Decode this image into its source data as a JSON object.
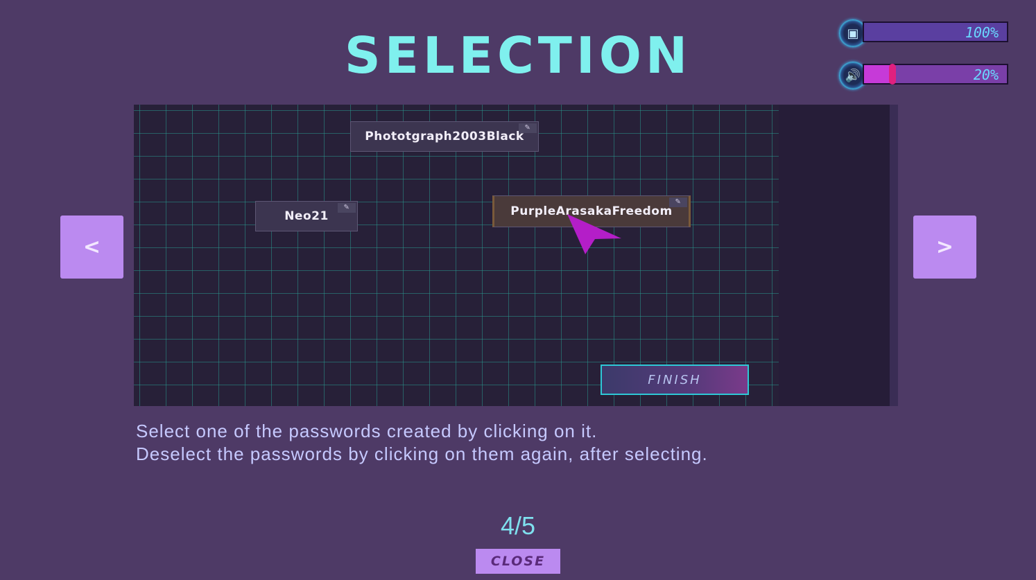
{
  "title": "SELECTION",
  "settings": {
    "brightness": {
      "icon": "screen-brightness-icon",
      "value": 1.0,
      "label": "100%",
      "color": "#5a3fa0"
    },
    "volume": {
      "icon": "speaker-volume-icon",
      "value": 0.2,
      "label": "20%",
      "color": "#c63ad8"
    }
  },
  "preview": {
    "passwords": [
      {
        "label": "Phototgraph2003Black",
        "selected": false
      },
      {
        "label": "Neo21",
        "selected": false
      },
      {
        "label": "PurpleArasakaFreedom",
        "selected": true
      }
    ],
    "finish_label": "FINISH"
  },
  "nav": {
    "prev_label": "<",
    "next_label": ">"
  },
  "description": {
    "line1": "Select one of the passwords created by clicking on it.",
    "line2": "Deselect the passwords by clicking on them again, after selecting."
  },
  "page_indicator": "4/5",
  "close_label": "CLOSE",
  "colors": {
    "background": "#4e3a66",
    "accent": "#7ff0ee",
    "button": "#bb8af0"
  }
}
